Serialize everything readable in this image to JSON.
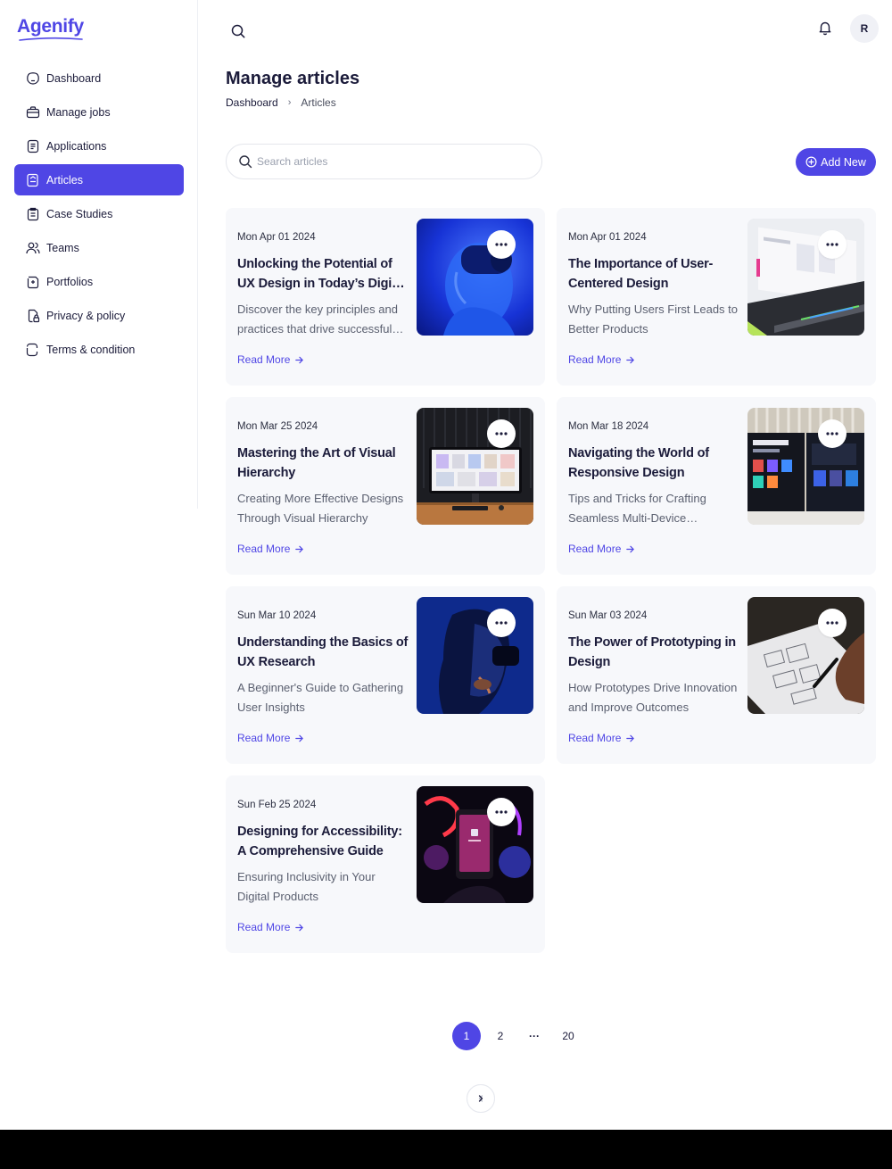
{
  "app": {
    "logo": "Agenify"
  },
  "sidebar": {
    "items": [
      {
        "label": "Dashboard",
        "icon": "dashboard-icon",
        "active": false
      },
      {
        "label": "Manage jobs",
        "icon": "briefcase-icon",
        "active": false
      },
      {
        "label": "Applications",
        "icon": "document-icon",
        "active": false
      },
      {
        "label": "Articles",
        "icon": "article-icon",
        "active": true
      },
      {
        "label": "Case Studies",
        "icon": "clipboard-icon",
        "active": false
      },
      {
        "label": "Teams",
        "icon": "users-icon",
        "active": false
      },
      {
        "label": "Portfolios",
        "icon": "portfolio-icon",
        "active": false
      },
      {
        "label": "Privacy & policy",
        "icon": "lock-icon",
        "active": false
      },
      {
        "label": "Terms & condition",
        "icon": "terms-icon",
        "active": false
      }
    ]
  },
  "topbar": {
    "avatar_initial": "R"
  },
  "header": {
    "title": "Manage articles",
    "breadcrumb": {
      "root": "Dashboard",
      "current": "Articles"
    }
  },
  "toolbar": {
    "search_placeholder": "Search articles",
    "search_value": "",
    "add_label": "Add New"
  },
  "articles": [
    {
      "date": "Mon Apr 01 2024",
      "title": "Unlocking the Potential of UX Design in Today’s Digital World",
      "description": "Discover the key principles and practices that drive successful user experiences",
      "read_more": "Read More",
      "image": "vr-headset-blue"
    },
    {
      "date": "Mon Apr 01 2024",
      "title": "The Importance of User-Centered Design",
      "description": "Why Putting Users First Leads to Better Products",
      "read_more": "Read More",
      "image": "laptop-screen"
    },
    {
      "date": "Mon Mar 25 2024",
      "title": "Mastering the Art of Visual Hierarchy",
      "description": "Creating More Effective Designs Through Visual Hierarchy",
      "read_more": "Read More",
      "image": "desk-monitor"
    },
    {
      "date": "Mon Mar 18 2024",
      "title": "Navigating the World of Responsive Design",
      "description": "Tips and Tricks for Crafting Seamless Multi-Device Experiences",
      "read_more": "Read More",
      "image": "dual-monitors"
    },
    {
      "date": "Sun Mar 10 2024",
      "title": "Understanding the Basics of UX Research",
      "description": "A Beginner's Guide to Gathering User Insights",
      "read_more": "Read More",
      "image": "vr-profile"
    },
    {
      "date": "Sun Mar 03 2024",
      "title": "The Power of Prototyping in Design",
      "description": "How Prototypes Drive Innovation and Improve Outcomes",
      "read_more": "Read More",
      "image": "wireframe-sketch"
    },
    {
      "date": "Sun Feb 25 2024",
      "title": "Designing for Accessibility: A Comprehensive Guide",
      "description": "Ensuring Inclusivity in Your Digital Products",
      "read_more": "Read More",
      "image": "phone-neon"
    }
  ],
  "pagination": {
    "current": "1",
    "next": "2",
    "ellipsis": "···",
    "last": "20"
  },
  "colors": {
    "accent": "#4f46e5",
    "card_bg": "#f7f8fb",
    "text": "#1b1b3a"
  }
}
